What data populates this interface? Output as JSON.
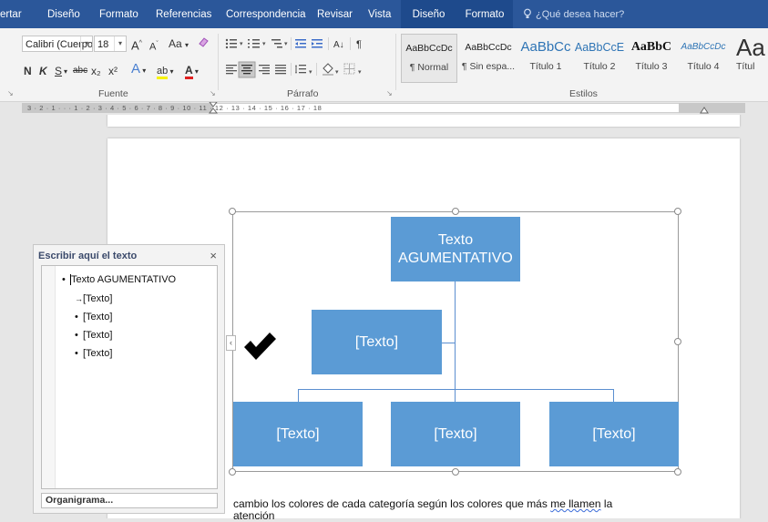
{
  "tabs": [
    "ertar",
    "Diseño",
    "Formato",
    "Referencias",
    "Correspondencia",
    "Revisar",
    "Vista"
  ],
  "context_tabs": [
    "Diseño",
    "Formato"
  ],
  "tell_me": "¿Qué desea hacer?",
  "font": {
    "name": "Calibri (Cuerpo",
    "size": "18",
    "group_label": "Fuente",
    "bold": "N",
    "italic": "K",
    "underline": "S",
    "strike": "abc",
    "subscript": "x₂",
    "superscript": "x²",
    "grow": "A",
    "shrink": "A",
    "case": "Aa",
    "effects": "A",
    "highlight": "ab",
    "color": "A"
  },
  "paragraph": {
    "group_label": "Párrafo",
    "sort": "A↓",
    "pilcrow": "¶"
  },
  "styles": {
    "group_label": "Estilos",
    "items": [
      {
        "preview": "AaBbCcDc",
        "name": "¶ Normal"
      },
      {
        "preview": "AaBbCcDc",
        "name": "¶ Sin espa..."
      },
      {
        "preview": "AaBbCc",
        "name": "Título 1"
      },
      {
        "preview": "AaBbCcE",
        "name": "Título 2"
      },
      {
        "preview": "AaBbC",
        "name": "Título 3"
      },
      {
        "preview": "AaBbCcDc",
        "name": "Título 4"
      },
      {
        "preview": "Aa",
        "name": "Títul"
      }
    ]
  },
  "ruler": {
    "numbers": "3 · 2 · 1 · · · 1 · 2 · 3 · 4 · 5 · 6 · 7 · 8 · 9 · 10 · 11 · 12 · 13 · 14 · 15 · 16 · 17 · 18"
  },
  "text_pane": {
    "title": "Escribir aquí el texto",
    "close": "×",
    "items": [
      {
        "bullet": "•",
        "text": "Texto AGUMENTATIVO"
      },
      {
        "bullet": "→",
        "text": "[Texto]"
      },
      {
        "bullet": "•",
        "text": "[Texto]"
      },
      {
        "bullet": "•",
        "text": "[Texto]"
      },
      {
        "bullet": "•",
        "text": "[Texto]"
      }
    ],
    "footer": "Organigrama..."
  },
  "smartart": {
    "top": "Texto AGUMENTATIVO",
    "assistant": "[Texto]",
    "children": [
      "[Texto]",
      "[Texto]",
      "[Texto]"
    ]
  },
  "document": {
    "line1_a": "cambio los colores de cada categoría según los colores que más ",
    "line1_b": "me  llamen",
    "line1_c": " la",
    "line2": "atención"
  },
  "colors": {
    "ribbon_tab_bg": "#2b579a",
    "shape_fill": "#5b9bd5",
    "connector": "#5b8fd0"
  }
}
